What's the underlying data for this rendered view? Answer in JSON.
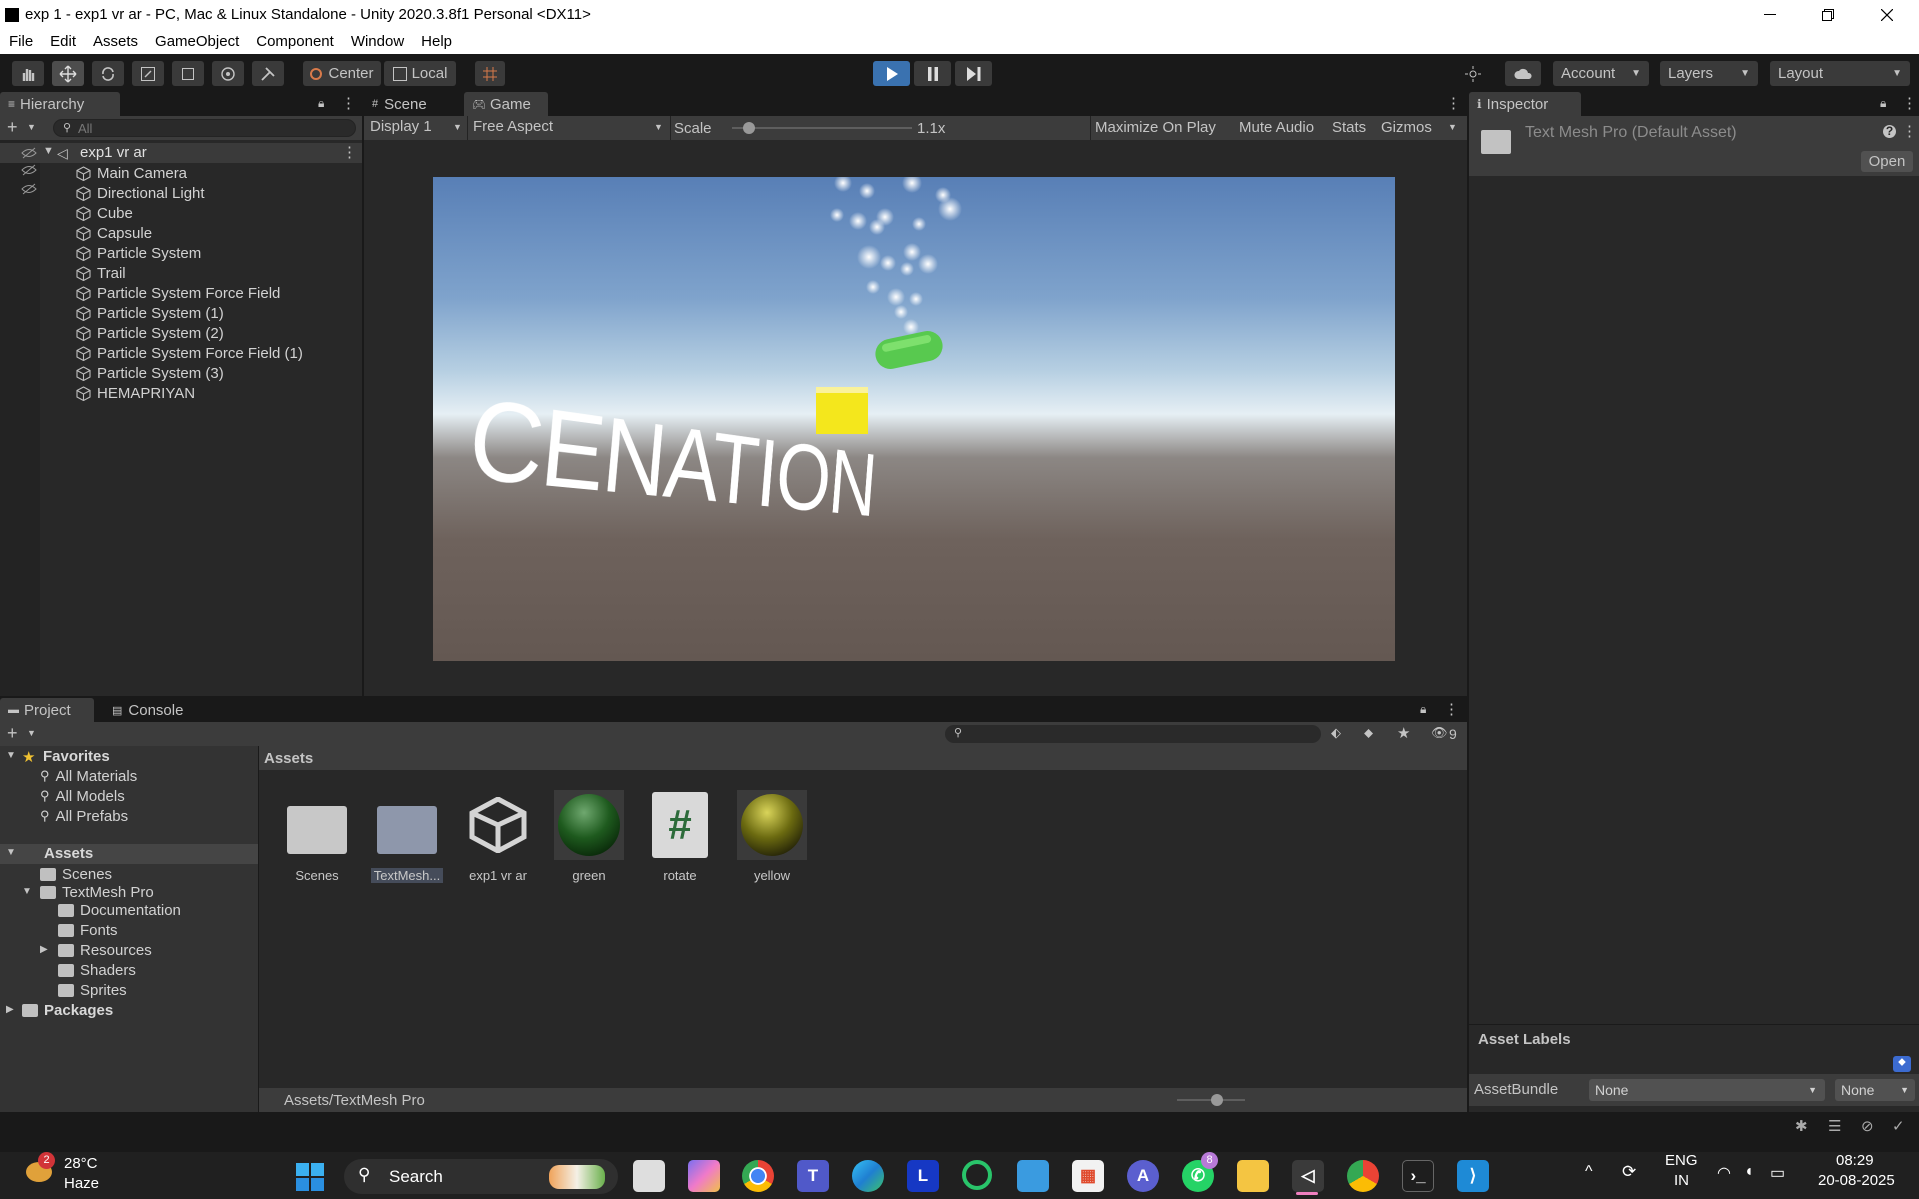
{
  "window": {
    "title": "exp 1 - exp1 vr ar - PC, Mac & Linux Standalone - Unity 2020.3.8f1 Personal <DX11>"
  },
  "menu": [
    "File",
    "Edit",
    "Assets",
    "GameObject",
    "Component",
    "Window",
    "Help"
  ],
  "toolbar": {
    "pivot_label": "Center",
    "space_label": "Local",
    "account_label": "Account",
    "layers_label": "Layers",
    "layout_label": "Layout"
  },
  "hierarchy": {
    "tab_label": "Hierarchy",
    "search_placeholder": "All",
    "scene_name": "exp1 vr ar",
    "items": [
      "Main Camera",
      "Directional Light",
      "Cube",
      "Capsule",
      "Particle System",
      "Trail",
      "Particle System Force Field",
      "Particle System (1)",
      "Particle System (2)",
      "Particle System Force Field (1)",
      "Particle System (3)",
      "HEMAPRIYAN"
    ]
  },
  "view": {
    "scene_tab": "Scene",
    "game_tab": "Game",
    "display": "Display 1",
    "aspect": "Free Aspect",
    "scale_label": "Scale",
    "scale_value": "1.1x",
    "scale_fraction": 0.06,
    "maximize": "Maximize On Play",
    "mute": "Mute Audio",
    "stats": "Stats",
    "gizmos": "Gizmos",
    "game_text": "CENATION"
  },
  "inspector": {
    "tab_label": "Inspector",
    "asset_title": "Text Mesh Pro (Default Asset)",
    "open_label": "Open",
    "labels_header": "Asset Labels",
    "bundle_label": "AssetBundle",
    "bundle_value": "None",
    "variant_value": "None"
  },
  "project": {
    "project_tab": "Project",
    "console_tab": "Console",
    "hidden_count": "9",
    "favorites_label": "Favorites",
    "favorites": [
      "All Materials",
      "All Models",
      "All Prefabs"
    ],
    "assets_label": "Assets",
    "tree": [
      "Scenes",
      "TextMesh Pro",
      "Documentation",
      "Fonts",
      "Resources",
      "Shaders",
      "Sprites"
    ],
    "packages_label": "Packages",
    "header": "Assets",
    "grid": [
      "Scenes",
      "TextMesh...",
      "exp1 vr ar",
      "green",
      "rotate",
      "yellow"
    ],
    "path": "Assets/TextMesh Pro"
  },
  "taskbar": {
    "temp": "28°C",
    "weather": "Haze",
    "weather_badge": "2",
    "search": "Search",
    "whatsapp_badge": "8",
    "lang1": "ENG",
    "lang2": "IN",
    "time": "08:29",
    "date": "20-08-2025"
  },
  "colors": {
    "editor_bg": "#282828",
    "play_active": "#3a72b0",
    "green_sphere": "#1e5a1e",
    "yellow_sphere": "#6b6a10"
  }
}
